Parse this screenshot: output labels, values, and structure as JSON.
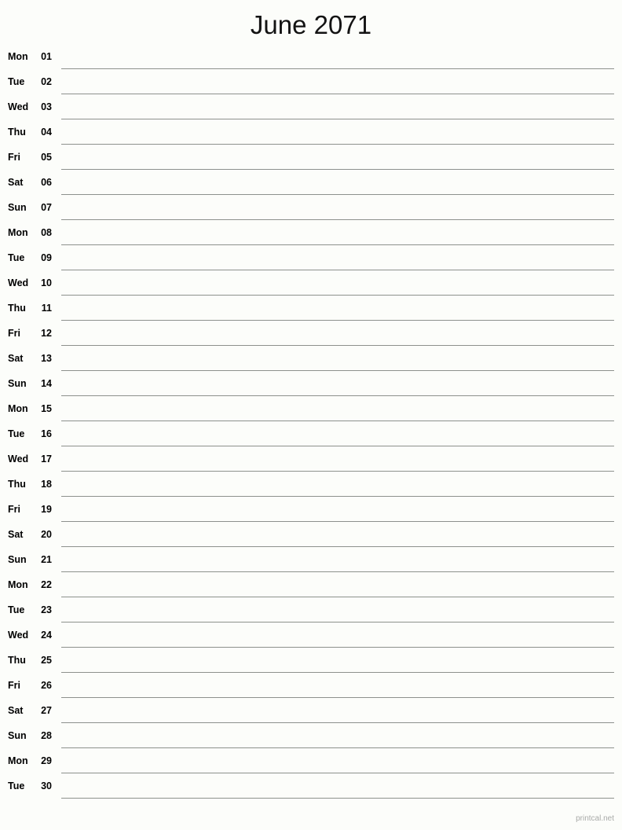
{
  "header": {
    "title": "June 2071"
  },
  "footer": {
    "credit": "printcal.net"
  },
  "calendar": {
    "month": "June",
    "year": "2071",
    "rows": [
      {
        "weekday": "Mon",
        "day": "01"
      },
      {
        "weekday": "Tue",
        "day": "02"
      },
      {
        "weekday": "Wed",
        "day": "03"
      },
      {
        "weekday": "Thu",
        "day": "04"
      },
      {
        "weekday": "Fri",
        "day": "05"
      },
      {
        "weekday": "Sat",
        "day": "06"
      },
      {
        "weekday": "Sun",
        "day": "07"
      },
      {
        "weekday": "Mon",
        "day": "08"
      },
      {
        "weekday": "Tue",
        "day": "09"
      },
      {
        "weekday": "Wed",
        "day": "10"
      },
      {
        "weekday": "Thu",
        "day": "11"
      },
      {
        "weekday": "Fri",
        "day": "12"
      },
      {
        "weekday": "Sat",
        "day": "13"
      },
      {
        "weekday": "Sun",
        "day": "14"
      },
      {
        "weekday": "Mon",
        "day": "15"
      },
      {
        "weekday": "Tue",
        "day": "16"
      },
      {
        "weekday": "Wed",
        "day": "17"
      },
      {
        "weekday": "Thu",
        "day": "18"
      },
      {
        "weekday": "Fri",
        "day": "19"
      },
      {
        "weekday": "Sat",
        "day": "20"
      },
      {
        "weekday": "Sun",
        "day": "21"
      },
      {
        "weekday": "Mon",
        "day": "22"
      },
      {
        "weekday": "Tue",
        "day": "23"
      },
      {
        "weekday": "Wed",
        "day": "24"
      },
      {
        "weekday": "Thu",
        "day": "25"
      },
      {
        "weekday": "Fri",
        "day": "26"
      },
      {
        "weekday": "Sat",
        "day": "27"
      },
      {
        "weekday": "Sun",
        "day": "28"
      },
      {
        "weekday": "Mon",
        "day": "29"
      },
      {
        "weekday": "Tue",
        "day": "30"
      }
    ]
  },
  "colors": {
    "background": "#fcfdfa",
    "text": "#000000",
    "rule": "#8d918d",
    "credit": "#a8aaa8"
  }
}
